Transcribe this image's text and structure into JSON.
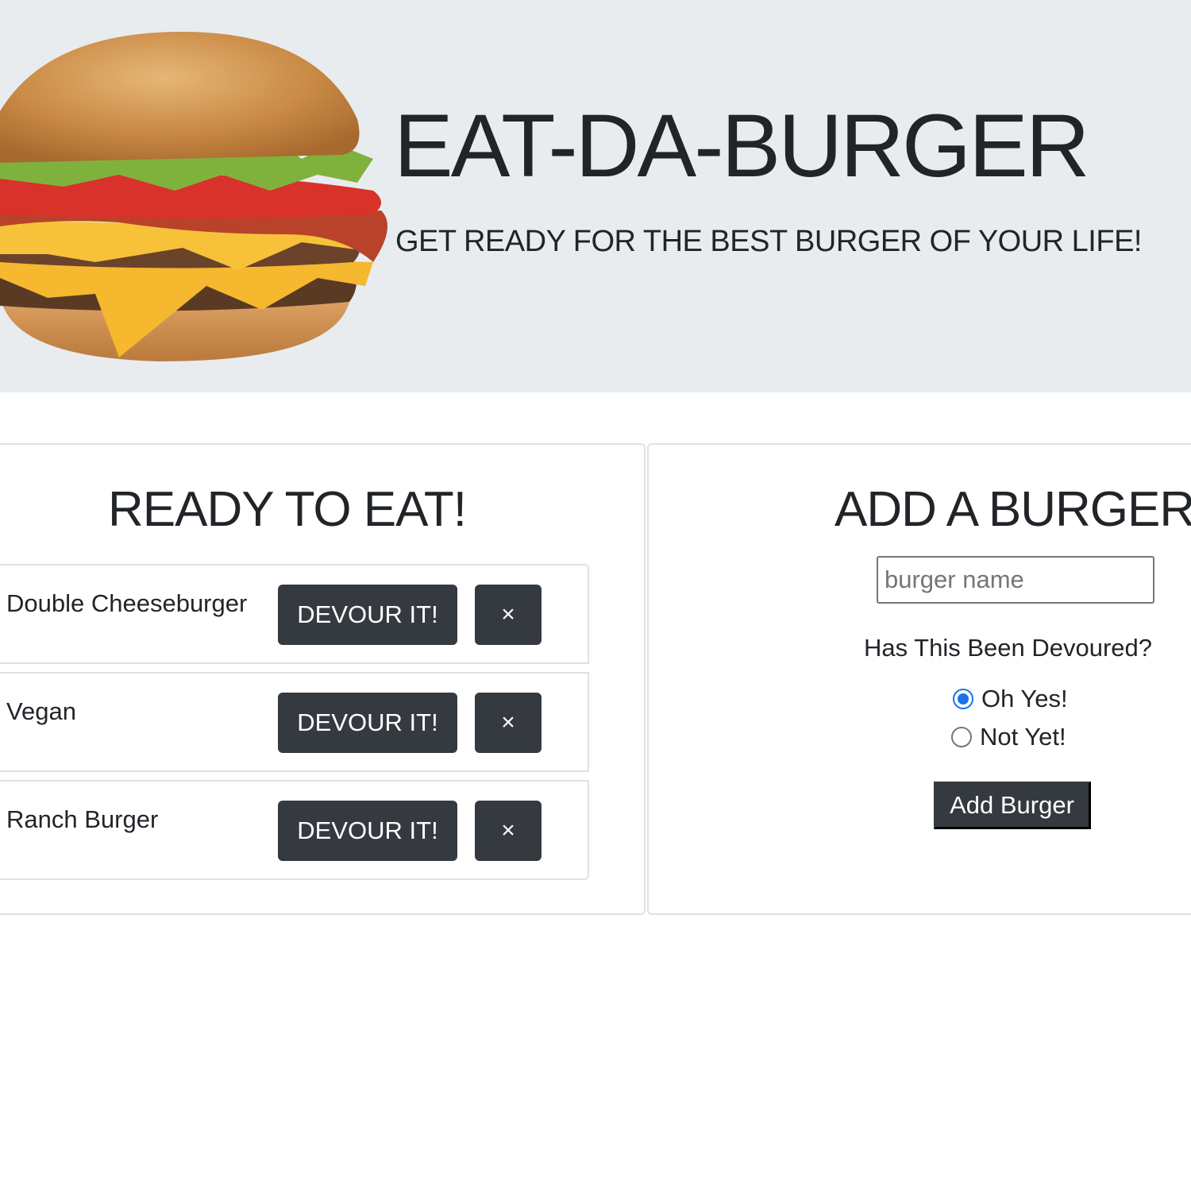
{
  "header": {
    "title": "EAT-DA-BURGER",
    "subtitle": "GET READY FOR THE BEST BURGER OF YOUR LIFE!"
  },
  "ready_section": {
    "heading": "READY TO EAT!",
    "devour_label": "DEVOUR IT!",
    "delete_label": "×",
    "burgers": [
      {
        "name": "Double Cheeseburger"
      },
      {
        "name": "Vegan"
      },
      {
        "name": "Ranch Burger"
      }
    ]
  },
  "add_section": {
    "heading": "ADD A BURGER",
    "input_placeholder": "burger name",
    "input_value": "",
    "question": "Has This Been Devoured?",
    "options": [
      {
        "label": "Oh Yes!",
        "checked": true
      },
      {
        "label": "Not Yet!",
        "checked": false
      }
    ],
    "submit_label": "Add Burger"
  },
  "colors": {
    "header_bg": "#e9ecef",
    "button_dark": "#343a40",
    "radio_accent": "#1a73e8"
  }
}
